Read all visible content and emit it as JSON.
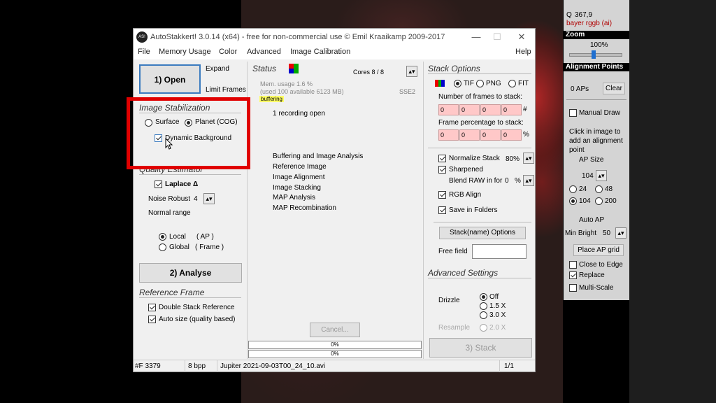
{
  "window": {
    "title": "AutoStakkert! 3.0.14 (x64) - free for non-commercial use © Emil Kraaikamp 2009-2017",
    "app_icon": "AS!",
    "controls": {
      "minimize": "—",
      "maximize": "☐",
      "close": "✕"
    }
  },
  "menu": [
    "File",
    "Memory Usage",
    "Color",
    "Advanced",
    "Image Calibration",
    "Help"
  ],
  "left": {
    "open_label": "1) Open",
    "expand": "Expand",
    "limit_frames": "Limit Frames",
    "stab_title": "Image Stabilization",
    "surface": "Surface",
    "planet": "Planet (COG)",
    "dynamic_bg": "Dynamic Background",
    "quality_title": "Quality Estimator",
    "laplace": "Laplace Δ",
    "noise_robust": "Noise Robust",
    "noise_value": "4",
    "normal_range": "Normal range",
    "local": "Local",
    "local_ap": "( AP )",
    "global": "Global",
    "global_frame": "( Frame )",
    "analyse_label": "2) Analyse",
    "ref_title": "Reference Frame",
    "double_stack": "Double Stack Reference",
    "auto_size": "Auto size (quality based)"
  },
  "center": {
    "status_title": "Status",
    "cores": "Cores 8 / 8",
    "mem_usage": "Mem. usage 1.6 %",
    "mem_detail": "(used 100 available 6123 MB)",
    "sse": "SSE2",
    "buffering": "buffering",
    "recording": "1 recording open",
    "steps": [
      "Buffering and Image Analysis",
      "Reference Image",
      "Image Alignment",
      "Image Stacking",
      "MAP Analysis",
      "MAP Recombination"
    ],
    "cancel": "Cancel...",
    "progress1": "0%",
    "progress2": "0%"
  },
  "stack": {
    "title": "Stack Options",
    "tif": "TIF",
    "png": "PNG",
    "fit": "FIT",
    "num_frames_label": "Number of frames to stack:",
    "num_frames": [
      "0",
      "0",
      "0",
      "0"
    ],
    "num_suffix": "#",
    "pct_label": "Frame percentage to stack:",
    "pct": [
      "0",
      "0",
      "0",
      "0"
    ],
    "pct_suffix": "%",
    "normalize": "Normalize Stack",
    "normalize_val": "80%",
    "sharpened": "Sharpened",
    "blend": "Blend RAW in for",
    "blend_val": "0",
    "blend_suffix": "%",
    "rgb_align": "RGB Align",
    "save_folders": "Save in Folders",
    "stackname_btn": "Stack(name) Options",
    "free_field": "Free field",
    "free_value": "",
    "adv_title": "Advanced Settings",
    "drizzle": "Drizzle",
    "off": "Off",
    "x15": "1.5 X",
    "x30": "3.0 X",
    "resample": "Resample",
    "x20": "2.0 X",
    "stack_btn": "3) Stack"
  },
  "statusbar": {
    "frame": "#F 3379",
    "bpp": "8 bpp",
    "file": "Jupiter 2021-09-03T00_24_10.avi",
    "page": "1/1"
  },
  "right": {
    "q": "Q",
    "q_value": "367,9",
    "bayer": "bayer rggb (ai)",
    "zoom_title": "Zoom",
    "zoom_value": "100%",
    "ap_title": "Alignment Points",
    "aps": "0 APs",
    "clear": "Clear",
    "manual_draw": "Manual Draw",
    "hint": "Click in image to add an alignment point",
    "ap_size": "AP Size",
    "ap_size_val": "104",
    "s24": "24",
    "s48": "48",
    "s104": "104",
    "s200": "200",
    "auto_ap": "Auto AP",
    "min_bright": "Min Bright",
    "min_bright_val": "50",
    "place_grid": "Place AP grid",
    "close_edge": "Close to Edge",
    "replace": "Replace",
    "multi_scale": "Multi-Scale"
  },
  "colors": {
    "highlight": "#e00000",
    "buffer_bg": "#ffff66"
  }
}
